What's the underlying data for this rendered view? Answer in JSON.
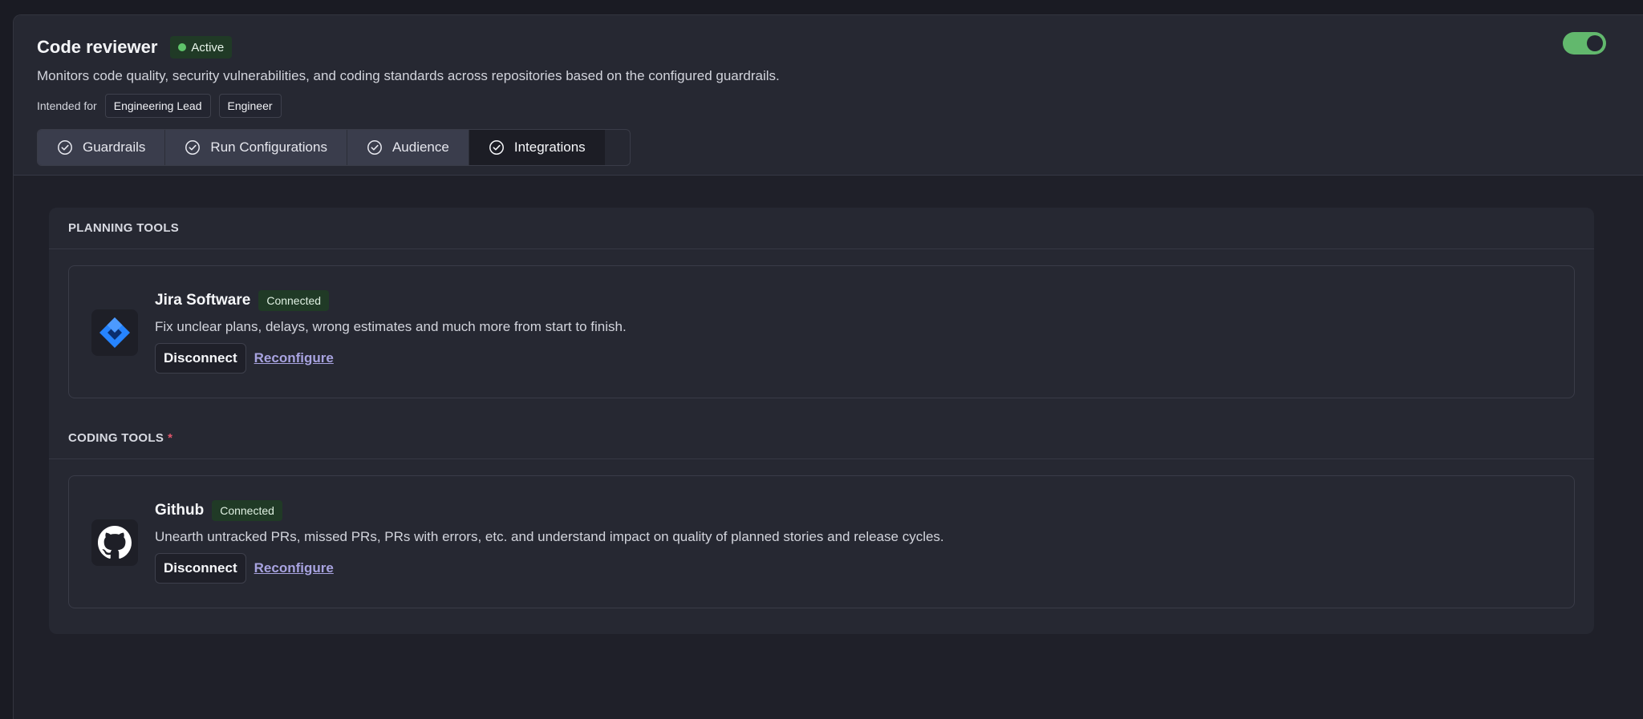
{
  "header": {
    "title": "Code reviewer",
    "status": "Active",
    "description": "Monitors code quality, security vulnerabilities, and coding standards across repositories based on the configured guardrails.",
    "intended_label": "Intended for",
    "roles": [
      "Engineering Lead",
      "Engineer"
    ],
    "toggle_on": true
  },
  "tabs": [
    {
      "label": "Guardrails",
      "icon": "check-circle-icon"
    },
    {
      "label": "Run Configurations",
      "icon": "check-circle-icon"
    },
    {
      "label": "Audience",
      "icon": "check-circle-icon"
    },
    {
      "label": "Integrations",
      "icon": "check-circle-icon",
      "selected": true
    }
  ],
  "sections": [
    {
      "heading": "PLANNING TOOLS",
      "required_mark": "",
      "integration": {
        "name": "Jira Software",
        "icon": "jira-logo-icon",
        "status": "Connected",
        "description": "Fix unclear plans, delays, wrong estimates and much more from start to finish.",
        "disconnect_label": "Disconnect",
        "reconfigure_label": "Reconfigure"
      }
    },
    {
      "heading": "CODING TOOLS",
      "required_mark": "*",
      "integration": {
        "name": "Github",
        "icon": "github-logo-icon",
        "status": "Connected",
        "description": "Unearth untracked PRs, missed PRs, PRs with errors, etc. and understand impact on quality of planned stories and release cycles.",
        "disconnect_label": "Disconnect",
        "reconfigure_label": "Reconfigure"
      }
    }
  ],
  "colors": {
    "accent_green": "#62b86d",
    "link_purple": "#a8a3e0",
    "required_red": "#e0556a",
    "jira_blue": "#2684ff"
  }
}
